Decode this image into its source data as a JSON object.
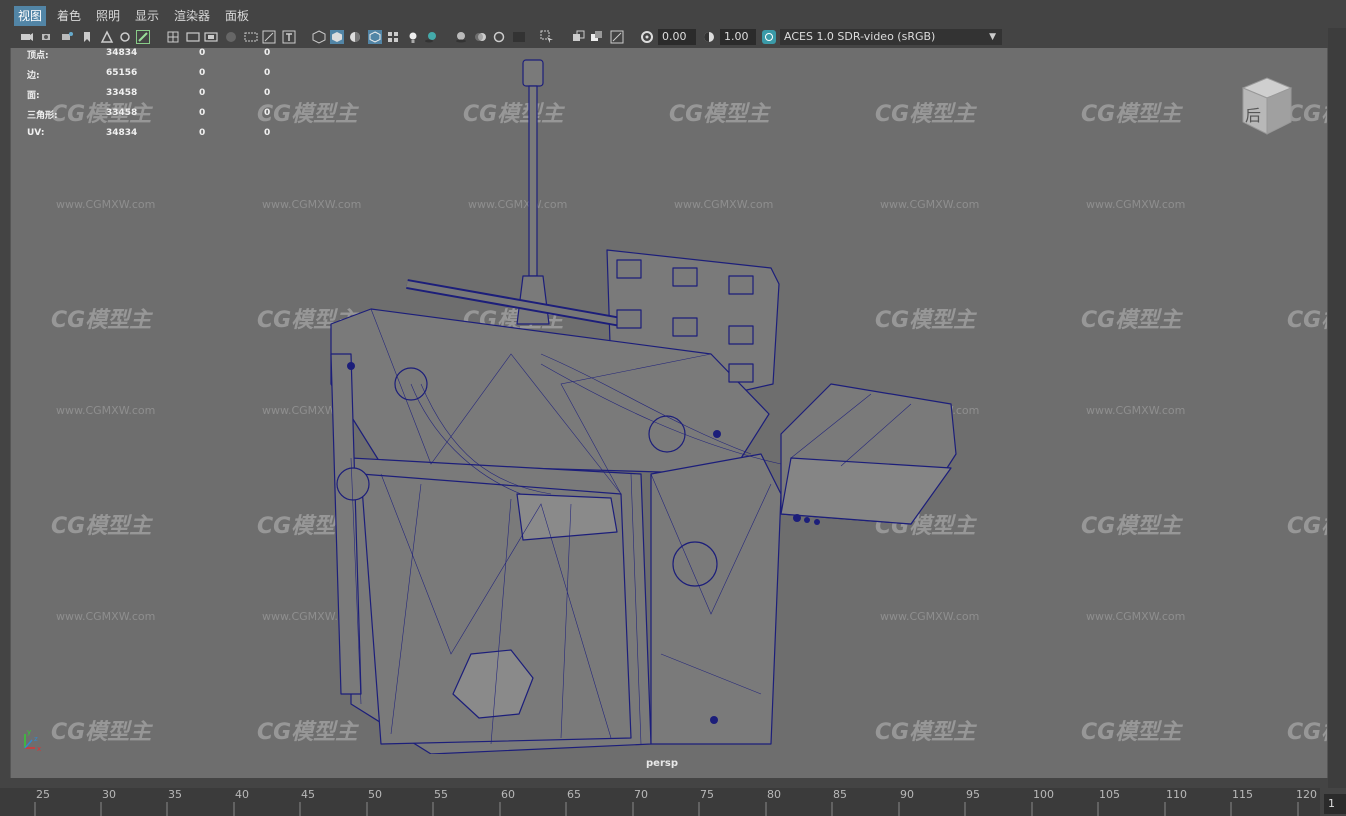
{
  "menu": {
    "items": [
      {
        "label": "视图",
        "active": true
      },
      {
        "label": "着色",
        "active": false
      },
      {
        "label": "照明",
        "active": false
      },
      {
        "label": "显示",
        "active": false
      },
      {
        "label": "渲染器",
        "active": false
      },
      {
        "label": "面板",
        "active": false
      }
    ]
  },
  "toolbar": {
    "exposure_value": "0.00",
    "gamma_value": "1.00",
    "color_space": "ACES 1.0 SDR-video (sRGB)"
  },
  "hud": {
    "rows": [
      {
        "label": "顶点:",
        "v1": "34834",
        "v2": "0",
        "v3": "0"
      },
      {
        "label": "边:",
        "v1": "65156",
        "v2": "0",
        "v3": "0"
      },
      {
        "label": "面:",
        "v1": "33458",
        "v2": "0",
        "v3": "0"
      },
      {
        "label": "三角形:",
        "v1": "33458",
        "v2": "0",
        "v3": "0"
      },
      {
        "label": "UV:",
        "v1": "34834",
        "v2": "0",
        "v3": "0"
      }
    ]
  },
  "viewport": {
    "camera_label": "persp",
    "viewcube_label": "后",
    "watermark_text": "CG模型主",
    "watermark_url": "www.CGMXW.com"
  },
  "timeline": {
    "ticks": [
      "25",
      "30",
      "35",
      "40",
      "45",
      "50",
      "55",
      "60",
      "65",
      "70",
      "75",
      "80",
      "85",
      "90",
      "95",
      "100",
      "105",
      "110",
      "115",
      "120"
    ],
    "current_frame": "1"
  },
  "colors": {
    "menu_active": "#5285a6",
    "wireframe": "#1c1e7a",
    "viewport_bg": "#6e6e6e"
  }
}
